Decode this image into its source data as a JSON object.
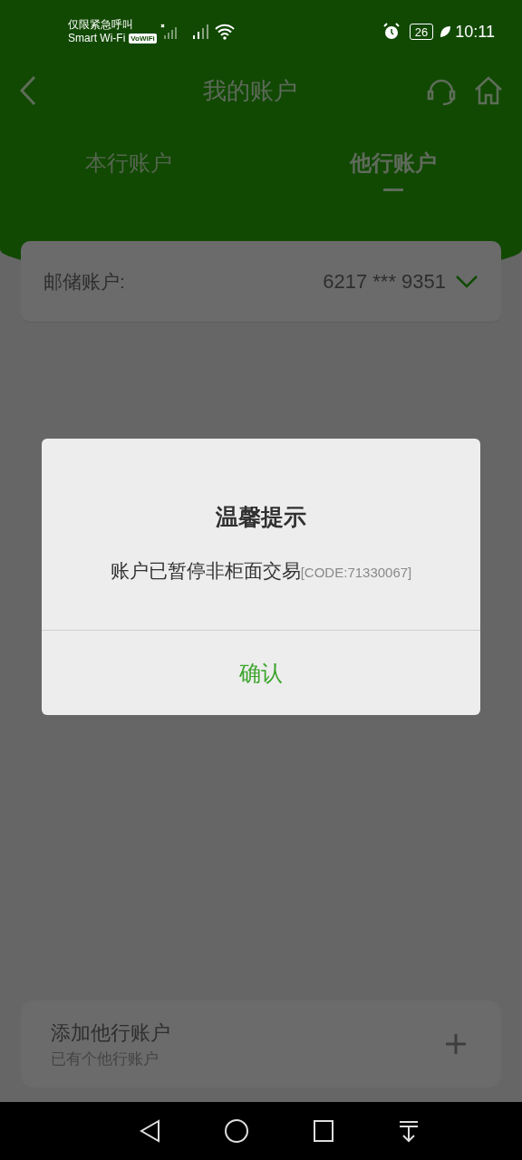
{
  "status_bar": {
    "carrier_line1": "仅限紧急呼叫",
    "carrier_line2": "Smart Wi-Fi",
    "vowifi_badge": "VoWiFi",
    "battery": "26",
    "time": "10:11"
  },
  "header": {
    "title": "我的账户"
  },
  "tabs": [
    {
      "label": "本行账户",
      "selected": false
    },
    {
      "label": "他行账户",
      "selected": true
    }
  ],
  "account": {
    "label": "邮储账户:",
    "number": "6217 *** 9351"
  },
  "dialog": {
    "title": "温馨提示",
    "message": "账户已暂停非柜面交易",
    "code": "[CODE:71330067]",
    "confirm": "确认"
  },
  "add_card": {
    "title": "添加他行账户",
    "subtitle": "已有个他行账户"
  }
}
